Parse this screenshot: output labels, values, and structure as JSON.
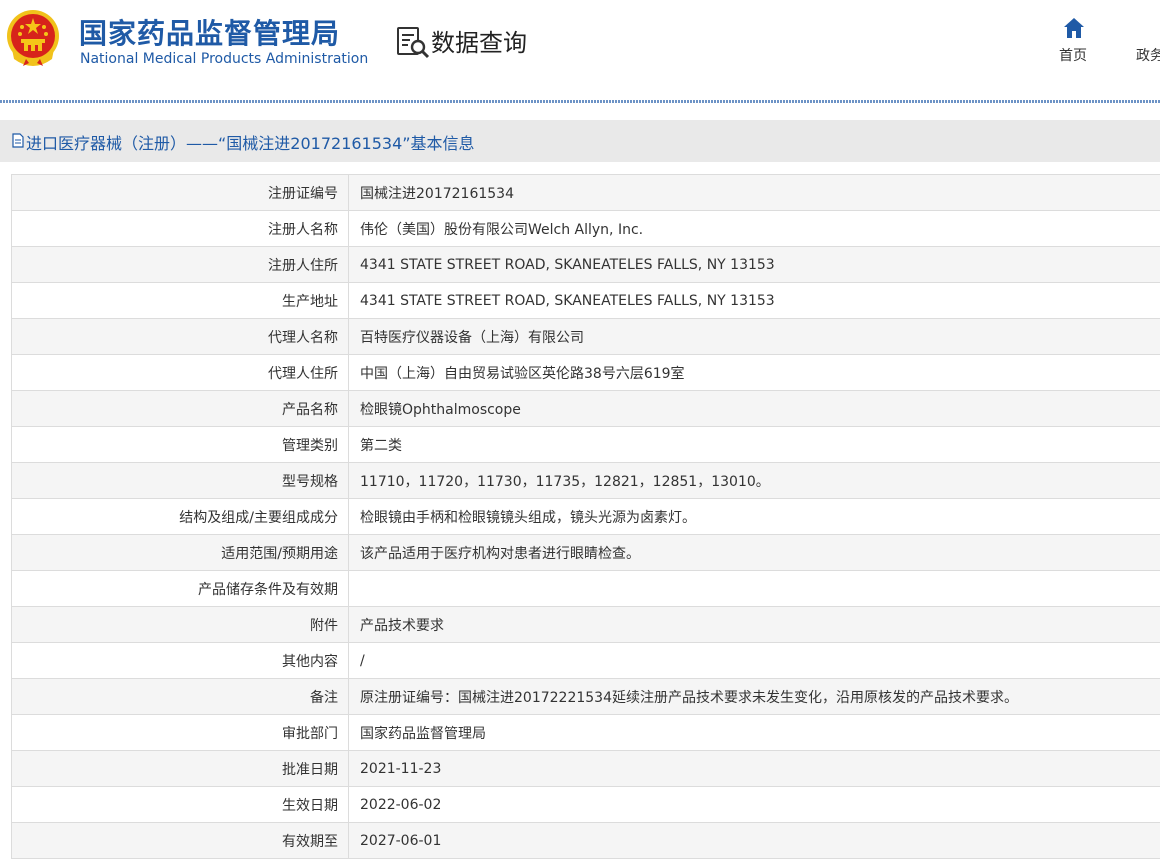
{
  "header": {
    "logo_cn": "国家药品监督管理局",
    "logo_en": "National Medical Products Administration",
    "section_title": "数据查询",
    "nav": {
      "home": "首页",
      "gov": "政务"
    }
  },
  "page": {
    "title": "进口医疗器械（注册）——“国械注进20172161534”基本信息"
  },
  "rows": [
    {
      "label": "注册证编号",
      "value": "国械注进20172161534"
    },
    {
      "label": "注册人名称",
      "value": "伟伦（美国）股份有限公司Welch Allyn, Inc."
    },
    {
      "label": "注册人住所",
      "value": "4341 STATE STREET ROAD, SKANEATELES FALLS, NY 13153"
    },
    {
      "label": "生产地址",
      "value": "4341 STATE STREET ROAD, SKANEATELES FALLS, NY 13153"
    },
    {
      "label": "代理人名称",
      "value": "百特医疗仪器设备（上海）有限公司"
    },
    {
      "label": "代理人住所",
      "value": "中国（上海）自由贸易试验区英伦路38号六层619室"
    },
    {
      "label": "产品名称",
      "value": "检眼镜Ophthalmoscope"
    },
    {
      "label": "管理类别",
      "value": "第二类"
    },
    {
      "label": "型号规格",
      "value": "11710，11720，11730，11735，12821，12851，13010。"
    },
    {
      "label": "结构及组成/主要组成成分",
      "value": "检眼镜由手柄和检眼镜镜头组成，镜头光源为卤素灯。"
    },
    {
      "label": "适用范围/预期用途",
      "value": "该产品适用于医疗机构对患者进行眼睛检查。"
    },
    {
      "label": "产品储存条件及有效期",
      "value": ""
    },
    {
      "label": "附件",
      "value": "产品技术要求"
    },
    {
      "label": "其他内容",
      "value": "/"
    },
    {
      "label": "备注",
      "value": "原注册证编号：国械注进20172221534延续注册产品技术要求未发生变化，沿用原核发的产品技术要求。"
    },
    {
      "label": "审批部门",
      "value": "国家药品监督管理局"
    },
    {
      "label": "批准日期",
      "value": "2021-11-23"
    },
    {
      "label": "生效日期",
      "value": "2022-06-02"
    },
    {
      "label": "有效期至",
      "value": "2027-06-01"
    }
  ],
  "colors": {
    "brand_blue": "#1f5aa6",
    "row_alt": "#f5f5f5",
    "emblem_red": "#d7231b",
    "emblem_gold": "#f5c518"
  },
  "icons": [
    "national-emblem-icon",
    "data-query-icon",
    "home-icon",
    "document-icon"
  ]
}
